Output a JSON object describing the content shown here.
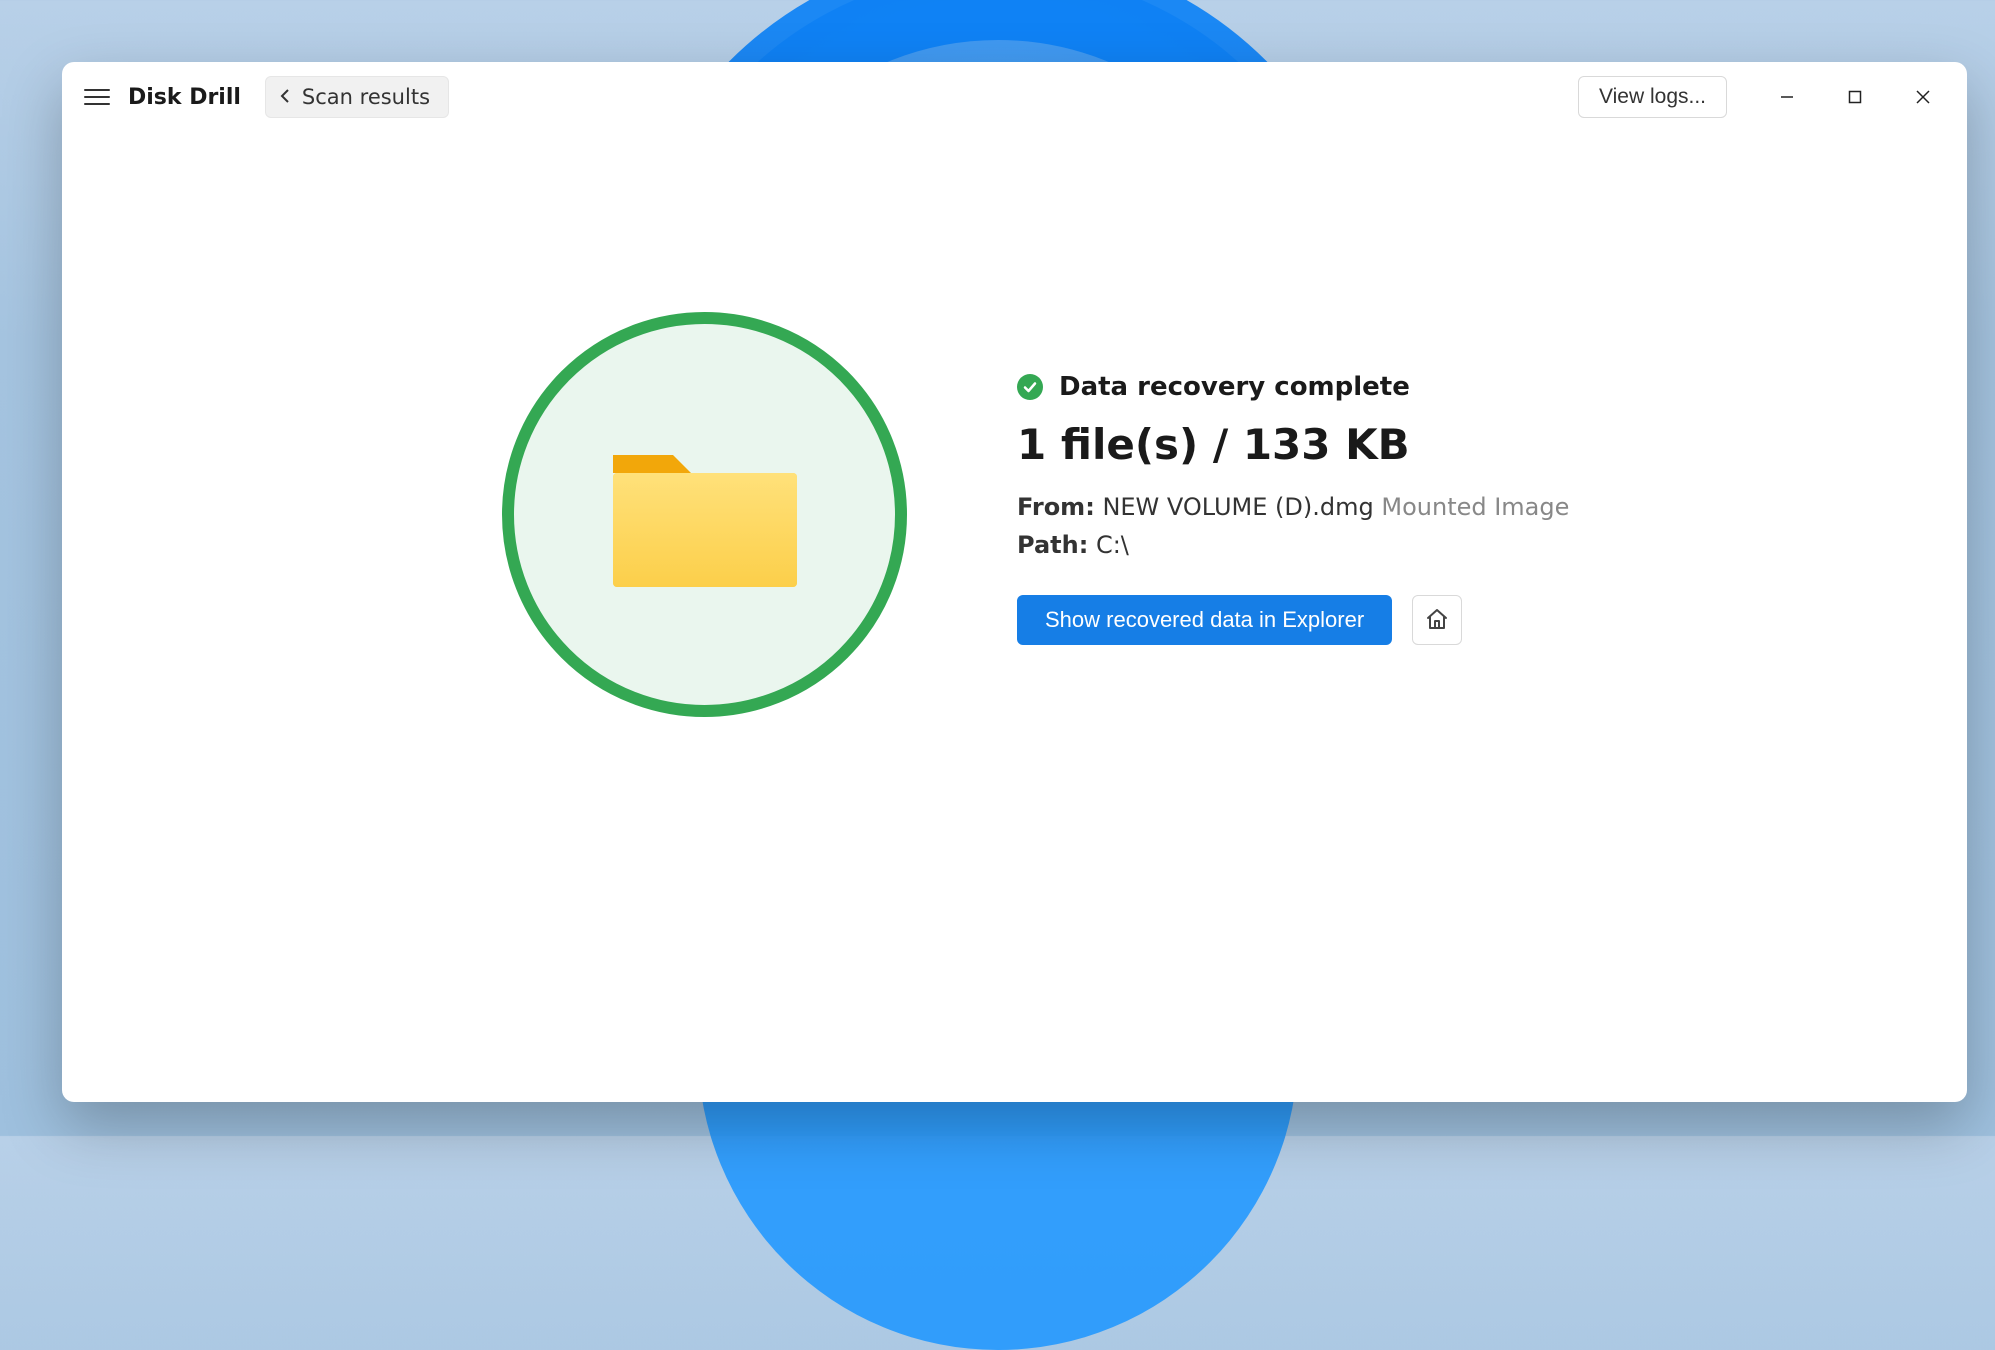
{
  "app": {
    "title": "Disk Drill"
  },
  "header": {
    "back_label": "Scan results",
    "view_logs_label": "View logs..."
  },
  "result": {
    "status_text": "Data recovery complete",
    "summary": "1 file(s) / 133 KB",
    "from_label": "From:",
    "from_value": "NEW VOLUME (D).dmg",
    "from_type": "Mounted Image",
    "path_label": "Path:",
    "path_value": "C:\\",
    "show_button": "Show recovered data in Explorer"
  }
}
